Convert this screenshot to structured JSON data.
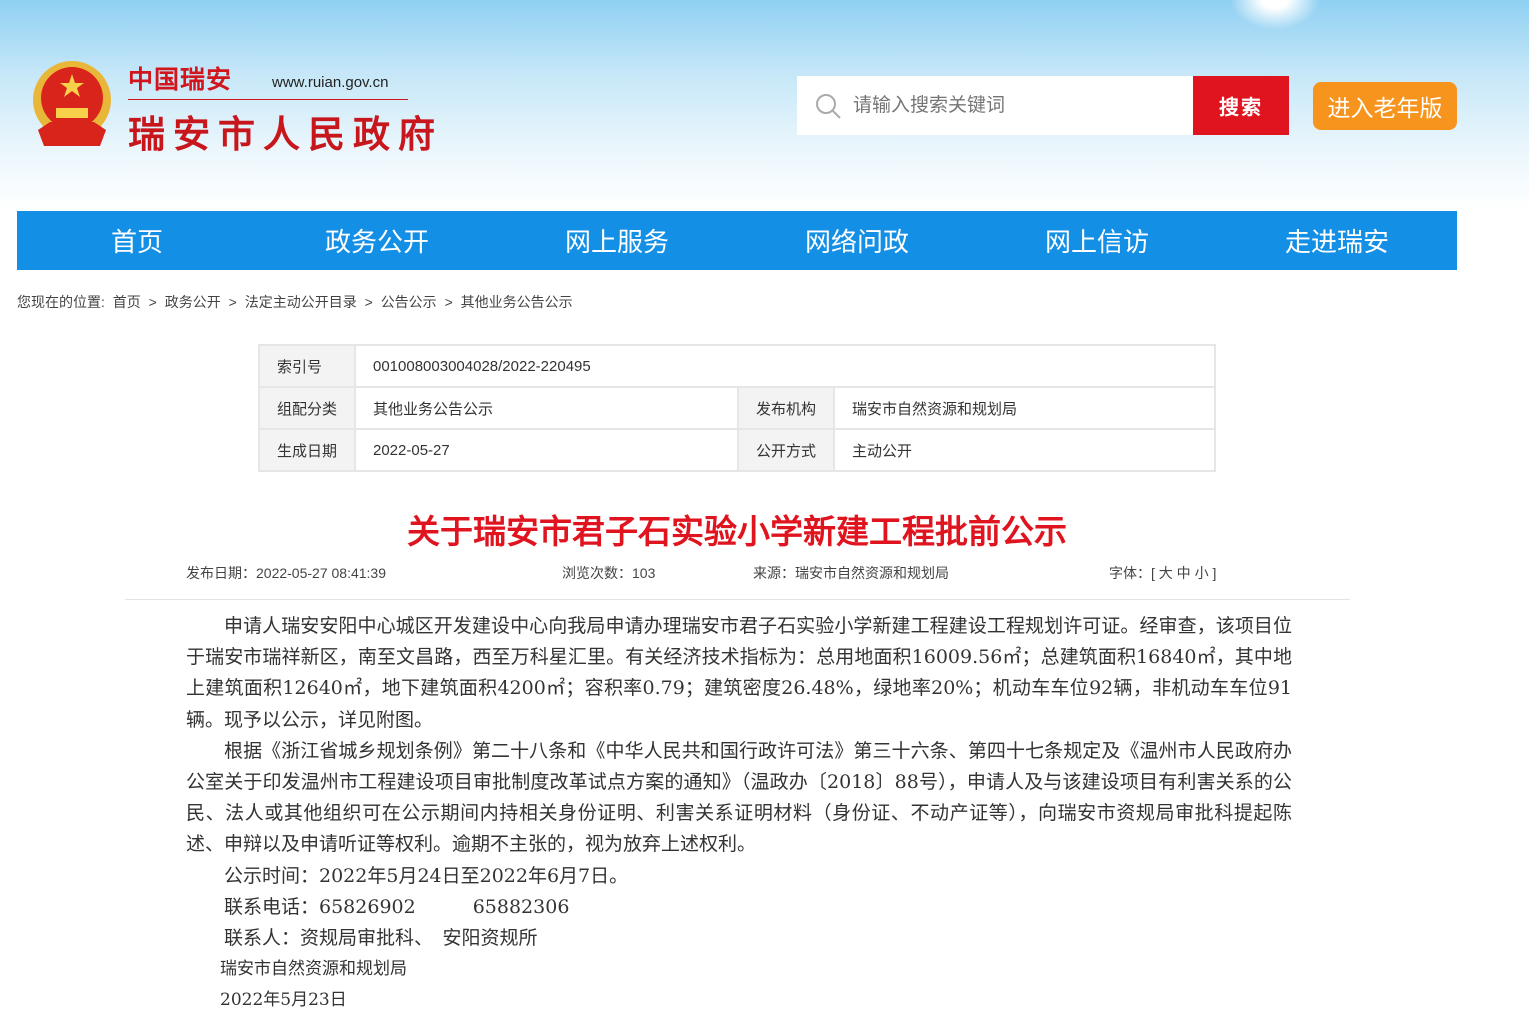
{
  "header": {
    "logo_cn": "中国瑞安",
    "logo_url": "www.ruian.gov.cn",
    "logo_main": "瑞安市人民政府",
    "search_placeholder": "请输入搜索关键词",
    "search_button": "搜索",
    "elder_button": "进入老年版"
  },
  "nav": [
    "首页",
    "政务公开",
    "网上服务",
    "网络问政",
    "网上信访",
    "走进瑞安"
  ],
  "breadcrumb": {
    "label": "您现在的位置:",
    "items": [
      "首页",
      ">",
      "政务公开",
      ">",
      "法定主动公开目录",
      ">",
      "公告公示",
      ">",
      "其他业务公告公示"
    ]
  },
  "meta": {
    "index_label": "索引号",
    "index_value": "001008003004028/2022-220495",
    "category_label": "组配分类",
    "category_value": "其他业务公告公示",
    "publisher_label": "发布机构",
    "publisher_value": "瑞安市自然资源和规划局",
    "date_label": "生成日期",
    "date_value": "2022-05-27",
    "mode_label": "公开方式",
    "mode_value": "主动公开"
  },
  "article": {
    "title": "关于瑞安市君子石实验小学新建工程批前公示",
    "publish_date": "发布日期：2022-05-27 08:41:39",
    "views": "浏览次数：103",
    "source": "来源：瑞安市自然资源和规划局",
    "font_label": "字体：[",
    "font_large": "大",
    "font_medium": "中",
    "font_small": "小",
    "font_end": "]",
    "paragraphs": [
      "申请人瑞安安阳中心城区开发建设中心向我局申请办理瑞安市君子石实验小学新建工程建设工程规划许可证。经审查，该项目位于瑞安市瑞祥新区，南至文昌路，西至万科星汇里。有关经济技术指标为：总用地面积16009.56㎡；总建筑面积16840㎡，其中地上建筑面积12640㎡，地下建筑面积4200㎡；容积率0.79；建筑密度26.48%，绿地率20%；机动车车位92辆，非机动车车位91辆。现予以公示，详见附图。",
      "根据《浙江省城乡规划条例》第二十八条和《中华人民共和国行政许可法》第三十六条、第四十七条规定及《温州市人民政府办公室关于印发温州市工程建设项目审批制度改革试点方案的通知》（温政办〔2018〕88号），申请人及与该建设项目有利害关系的公民、法人或其他组织可在公示期间内持相关身份证明、利害关系证明材料（身份证、不动产证等），向瑞安市资规局审批科提起陈述、申辩以及申请听证等权利。逾期不主张的，视为放弃上述权利。",
      "公示时间：2022年5月24日至2022年6月7日。",
      "联系电话：65826902　　　65882306",
      "联系人：资规局审批科、　安阳资规所"
    ],
    "sign_org": "瑞安市自然资源和规划局",
    "sign_date": "2022年5月23日"
  }
}
